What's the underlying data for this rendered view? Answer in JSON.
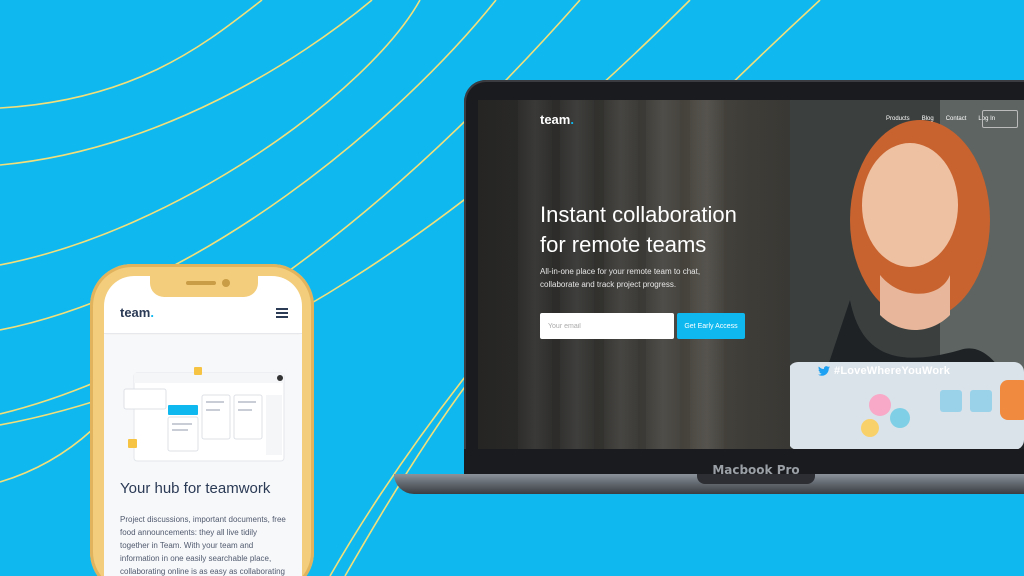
{
  "colors": {
    "background": "#0fb9ef",
    "accent": "#0fb9ef",
    "lines": "#f3df7a",
    "phone_frame": "#f3cd7b"
  },
  "laptop": {
    "label": "Macbook Pro",
    "site": {
      "logo_text": "team",
      "logo_dot": ".",
      "nav": [
        "Products",
        "Blog",
        "Contact",
        "Log In"
      ],
      "hero_title_line1": "Instant collaboration",
      "hero_title_line2": "for remote teams",
      "hero_subtitle_line1": "All-in-one place for your remote team to chat,",
      "hero_subtitle_line2": "collaborate and track project progress.",
      "email_placeholder": "Your email",
      "cta_label": "Get Early Access",
      "photo_hashtag": "#LoveWhereYouWork"
    }
  },
  "phone": {
    "logo_text": "team",
    "logo_dot": ".",
    "menu_icon": "hamburger-icon",
    "heading": "Your hub for teamwork",
    "paragraph_lines": [
      "Project discussions, important documents, free",
      "food announcements: they all live tidily",
      "together in Team. With your team and",
      "information in one easily searchable place,",
      "collaborating online is as easy as collaborating"
    ]
  }
}
